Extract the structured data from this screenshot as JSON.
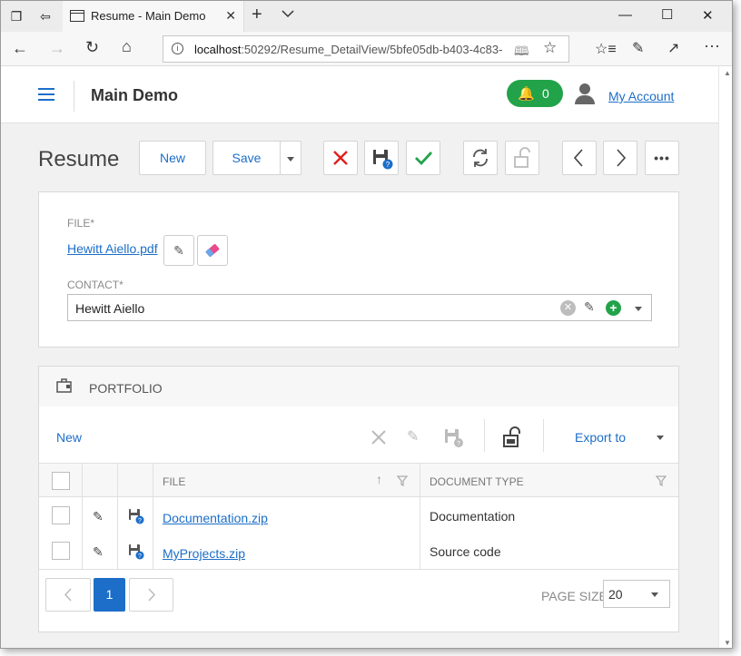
{
  "browser": {
    "tab_title": "Resume - Main Demo",
    "url_host": "localhost",
    "url_rest": ":50292/Resume_DetailView/5bfe05db-b403-4c83-"
  },
  "app": {
    "title": "Main Demo",
    "notification_count": "0",
    "account_label": "My Account"
  },
  "toolbar": {
    "page_title": "Resume",
    "new_label": "New",
    "save_label": "Save"
  },
  "form": {
    "file_label": "FILE*",
    "file_value": "Hewitt Aiello.pdf",
    "contact_label": "CONTACT*",
    "contact_value": "Hewitt Aiello"
  },
  "portfolio": {
    "header": "PORTFOLIO",
    "new_label": "New",
    "export_label": "Export to",
    "columns": [
      "FILE",
      "DOCUMENT TYPE"
    ],
    "rows": [
      {
        "file": "Documentation.zip",
        "type": "Documentation"
      },
      {
        "file": "MyProjects.zip",
        "type": "Source code"
      }
    ],
    "pager": {
      "current_page": "1",
      "page_size_label": "PAGE SIZE",
      "page_size": "20"
    }
  },
  "colors": {
    "accent": "#1c6ec8",
    "success": "#22a34a",
    "danger": "#e02020"
  }
}
